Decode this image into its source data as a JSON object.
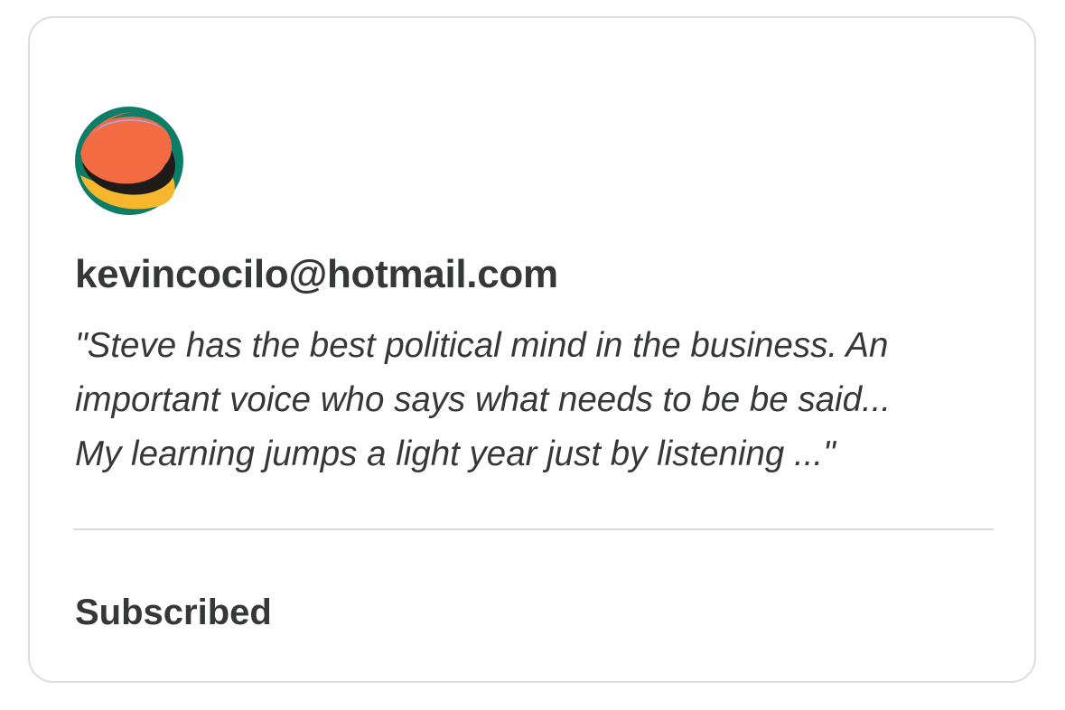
{
  "card": {
    "avatar_icon": "abstract-multicolor-circle-avatar-icon",
    "email": "kevincocilo@hotmail.com",
    "quote_lines": [
      "\"Steve has the best political mind in the business. An",
      "important voice who says what needs to be be said...",
      "My learning jumps a light year just by listening ...\""
    ],
    "status": "Subscribed"
  },
  "colors": {
    "text": "#363737",
    "border": "#dddddd",
    "divider": "#d9d9d9",
    "avatar_orange": "#f26b43",
    "avatar_teal": "#0d7d68",
    "avatar_yellow": "#f6b62d",
    "avatar_lavender": "#a8a3e2",
    "avatar_dark": "#1f1b18"
  }
}
